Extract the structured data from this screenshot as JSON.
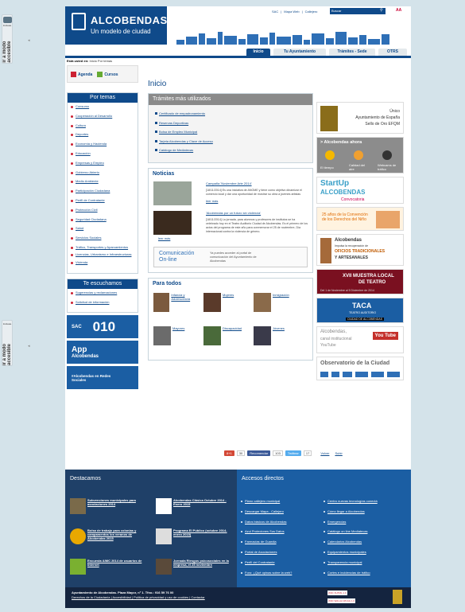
{
  "accessibility_tab": {
    "label": "Incluate",
    "text": "ir a modo accesible"
  },
  "header": {
    "logo_title": "ALCOBENDAS",
    "logo_subtitle": "Un modelo de ciudad",
    "top_links": [
      "SAC",
      "Mapa Web",
      "Callejero"
    ],
    "search_placeholder": "Buscar",
    "font_size_label": "AA"
  },
  "nav": {
    "tabs": [
      "Inicio",
      "Tu Ayuntamiento",
      "Trámites - Sede",
      "OTRS"
    ]
  },
  "breadcrumb": {
    "prefix": "Está usted en:",
    "path": "Inicio Por temas"
  },
  "quick_links": [
    "Agenda",
    "Cursos"
  ],
  "sidebar": {
    "temas_title": "Por temas",
    "temas": [
      "Consumo",
      "Cooperación al Desarrollo",
      "Cultura",
      "Deportes",
      "Economía y Hacienda",
      "Educación",
      "Empresas y Empleo",
      "Gobierno Abierto",
      "Medio Ambiente",
      "Participación Ciudadana",
      "Perfil de Contratante",
      "Protección Civil",
      "Seguridad Ciudadana",
      "Salud",
      "Servicios Sociales",
      "Tráfico, Transportes y Aparcamientos",
      "Licencias, Urbanismo e Infraestructuras",
      "Vivienda"
    ],
    "escuchamos_title": "Te escuchamos",
    "escuchamos": [
      "Sugerencias y reclamaciones",
      "Solicitud de información"
    ],
    "promo_sac": {
      "label": "SAC",
      "number": "010"
    },
    "promo_app": {
      "label": "App",
      "sub": "Alcobendas"
    },
    "promo_social": "#Alcobendas en Redes Sociales"
  },
  "main": {
    "title": "Inicio",
    "tramites_title": "Trámites más utilizados",
    "tramites": [
      "Certificado de empadronamiento",
      "Reservas Deportivas",
      "Bolsa de Empleo Municipal",
      "Tarjeta Alcobendas y Clave de Acceso",
      "Catálogo de Mediatecas"
    ],
    "noticias_title": "Noticias",
    "noticias": [
      {
        "title": "Campaña 'Noviembre Arte 2014'",
        "text": "[18/11/2014] Es una iniciativa de ANOME y tiene como objetivo dinamizar el comercio local y dar una oportunidad de mostrar su obra a jóvenes artistas",
        "more": "leer más"
      },
      {
        "title": "'Alcobendas por un futuro sin violencia'",
        "text": "[18/11/2014] La jornada, para alumnos y profesores de institutos se ha celebrado hoy en el Teatro Auditorio Ciudad de Alcobendas. Es el primero de los actos del programa de este año para conmemorar el 25 de noviembre, Día internacional contra la violencia de género.",
        "more": "leer más"
      }
    ],
    "comunicacion": {
      "line1": "Comunicación",
      "line2": "On-line",
      "text": "Ya puedes acceder al portal de comunicación del Ayuntamiento de Alcobendas"
    },
    "paratodos_title": "Para todos",
    "paratodos": [
      "Infancia y Adolescencia",
      "Mujeres",
      "Inmigración",
      "Mayores",
      "Discapacidad",
      "Jóvenes"
    ],
    "share": {
      "gplus": "8+1",
      "gplus_count": "30",
      "fb": "Recomendar",
      "fb_count": "103",
      "tw": "Twittear",
      "tw_count": "17",
      "back": "Volver",
      "up": "Subir"
    }
  },
  "right": {
    "efqm": {
      "l1": "Único",
      "l2": "Ayuntamiento de España",
      "l3": "Sello de Oro EFQM"
    },
    "ahora": {
      "title": "> Alcobendas ahora",
      "items": [
        "El tiempo",
        "Calidad del aire",
        "Webcams de tráfico"
      ]
    },
    "startup": {
      "l1": "StartUp",
      "l2": "ALCOBENDAS",
      "l3": "Convocatoria"
    },
    "convencion": {
      "l1": "25 años de la Convención de los Derechos del Niño"
    },
    "oficios": {
      "l1": "Alcobendas",
      "l2": "Impulsa la recuperación de",
      "l3": "OFICIOS TRADICIONALES",
      "l4": "Y ARTESANALES"
    },
    "teatro": {
      "l1": "XVII MUESTRA LOCAL",
      "l2": "DE TEATRO",
      "l3": "Del 1 de Noviembre al 5 Diciembre de 2014"
    },
    "taca": {
      "l1": "TACA",
      "l2": "TEATRO AUDITORIO",
      "l3": "CIUDAD DE ALCOBENDAS"
    },
    "youtube": {
      "l1": "Alcobendas,",
      "l2": "canal institucional",
      "l3": "YouTube",
      "badge": "You Tube"
    },
    "observatorio": {
      "l1": "Observatorio de la Ciudad"
    }
  },
  "footer": {
    "destacamos_title": "Destacamos",
    "destacamos": [
      "Subvenciones municipales para asociaciones 2014",
      "Alcobendas Clásica Octubre 2014 - Enero 2015",
      "Bolsa de trabajo para colonias y campamentos los veranos de Alcobendas 2015",
      "Programa El Público (octubre 2014-enero 2015)",
      "Encuesta AIMC 2014 de usuarios de Internet",
      "Jornada Riesgos psicosociales en la empresa, el 25 noviembre"
    ],
    "accesos_title": "Accesos directos",
    "accesos_left": [
      "Plano callejero municipal",
      "Descargar Mapa - Callejero",
      "Datos básicos de Alcobendas",
      "Azul Proteciones Sus Datos",
      "Farmacias de Guardia",
      "Portal de Asociaciones",
      "Perfil del Contratante",
      "Foro: ¿Qué opinas sobre la web?"
    ],
    "accesos_right": [
      "Centro nuevas tecnologías conectá",
      "Cómo llegar a Alcobendas",
      "Emergencias",
      "Catálogo on line Mediatecas",
      "Calendarios Alcobendas",
      "Equipamientos municipales",
      "Transparencia municipal",
      "Cortes e incidencias de tráfico"
    ],
    "address": "Ayuntamiento de Alcobendas. Plaza Mayor, nº 1. Tfno.: 916 59 76 00",
    "legal": "Derechos de la Ciudadanía | Accesibilidad | Política de privacidad y uso de cookies | Contactar",
    "seals": [
      "W3C XHTML 1.0",
      "W3C WAI-AA WCAG 1.0"
    ]
  }
}
